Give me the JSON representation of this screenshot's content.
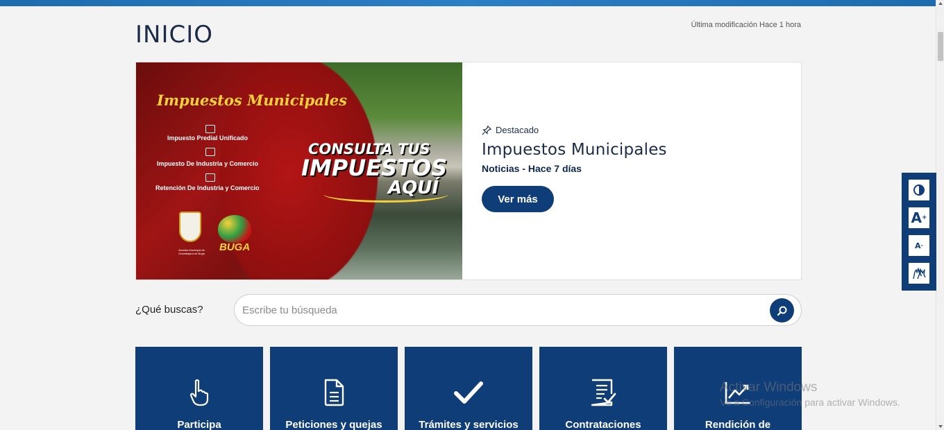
{
  "page": {
    "title": "INICIO",
    "last_modified": "Última modificación Hace 1 hora"
  },
  "featured": {
    "image_text": {
      "title": "Impuestos Municipales",
      "items": [
        "Impuesto Predial Unificado",
        "Impuesto De Industria y Comercio",
        "Retención De Industria y Comercio"
      ],
      "headline_1": "CONSULTA TUS",
      "headline_2": "IMPUESTOS",
      "headline_3": "AQUÍ",
      "logo_text": "BUGA",
      "seal_caption": "Alcaldía Municipal de Guadalajara de Buga"
    },
    "tag": "Destacado",
    "title": "Impuestos Municipales",
    "meta": "Noticias - Hace 7 días",
    "button_label": "Ver más"
  },
  "search": {
    "label": "¿Qué buscas?",
    "placeholder": "Escribe tu búsqueda",
    "value": ""
  },
  "tiles": [
    {
      "label": "Participa",
      "icon": "hand-pointer-icon"
    },
    {
      "label": "Peticiones y quejas",
      "icon": "document-icon"
    },
    {
      "label": "Trámites y servicios",
      "icon": "checkmark-icon"
    },
    {
      "label": "Contrataciones",
      "icon": "checklist-document-icon"
    },
    {
      "label": "Rendición de",
      "icon": "trend-chart-icon"
    }
  ],
  "accessibility": {
    "font_increase": "A",
    "font_decrease": "A"
  },
  "watermark": {
    "line1": "Activar Windows",
    "line2": "Ve a Configuración para activar Windows."
  },
  "colors": {
    "brand_blue": "#0f3d78",
    "top_bar": "#1f6bb0",
    "background": "#f3f3f3"
  }
}
